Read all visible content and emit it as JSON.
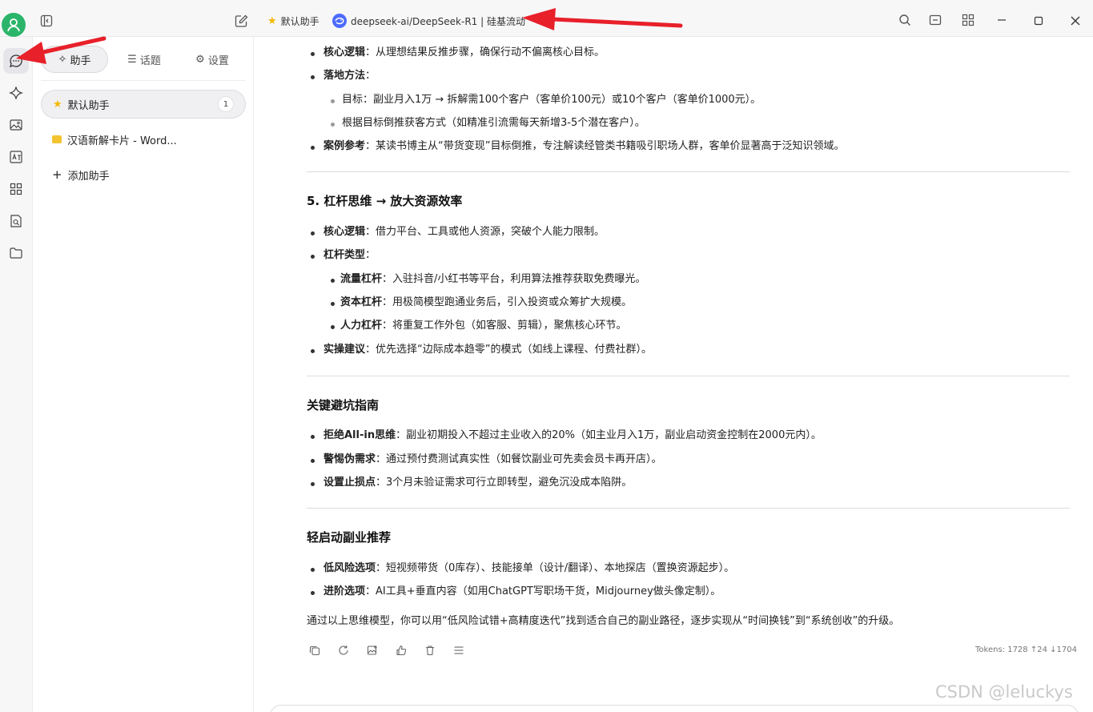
{
  "titlebar": {
    "assistant_tab": "默认助手",
    "model_tab": "deepseek-ai/DeepSeek-R1 | 硅基流动"
  },
  "sidebar": {
    "tabs": [
      {
        "label": "助手",
        "icon": "sparkle-icon"
      },
      {
        "label": "话题",
        "icon": "list-icon"
      },
      {
        "label": "设置",
        "icon": "gear-icon"
      }
    ],
    "items": [
      {
        "label": "默认助手",
        "icon": "star-icon",
        "badge": "1"
      },
      {
        "label": "汉语新解卡片 - Word...",
        "icon": "card-icon"
      }
    ],
    "add_label": "添加助手"
  },
  "message": {
    "s4_logic_label": "核心逻辑",
    "s4_logic_text": "：从理想结果反推步骤，确保行动不偏离核心目标。",
    "s4_method_label": "落地方法",
    "s4_method_colon": "：",
    "s4_method_1": "目标：副业月入1万 → 拆解需100个客户（客单价100元）或10个客户（客单价1000元）。",
    "s4_method_2": "根据目标倒推获客方式（如精准引流需每天新增3-5个潜在客户）。",
    "s4_case_label": "案例参考",
    "s4_case_text": "：某读书博主从“带货变现”目标倒推，专注解读经管类书籍吸引职场人群，客单价显著高于泛知识领域。",
    "s5_heading": "5. 杠杆思维 → 放大资源效率",
    "s5_logic_label": "核心逻辑",
    "s5_logic_text": "：借力平台、工具或他人资源，突破个人能力限制。",
    "s5_type_label": "杠杆类型",
    "s5_type_colon": "：",
    "s5_traffic_label": "流量杠杆",
    "s5_traffic_text": "：入驻抖音/小红书等平台，利用算法推荐获取免费曝光。",
    "s5_capital_label": "资本杠杆",
    "s5_capital_text": "：用极简模型跑通业务后，引入投资或众筹扩大规模。",
    "s5_labor_label": "人力杠杆",
    "s5_labor_text": "：将重复工作外包（如客服、剪辑），聚焦核心环节。",
    "s5_advice_label": "实操建议",
    "s5_advice_text": "：优先选择“边际成本趋零”的模式（如线上课程、付费社群）。",
    "pit_heading": "关键避坑指南",
    "pit_1_label": "拒绝All-in思维",
    "pit_1_text": "：副业初期投入不超过主业收入的20%（如主业月入1万，副业启动资金控制在2000元内）。",
    "pit_2_label": "警惕伪需求",
    "pit_2_text": "：通过预付费测试真实性（如餐饮副业可先卖会员卡再开店）。",
    "pit_3_label": "设置止损点",
    "pit_3_text": "：3个月未验证需求可行立即转型，避免沉没成本陷阱。",
    "rec_heading": "轻启动副业推荐",
    "rec_1_label": "低风险选项",
    "rec_1_text": "：短视频带货（0库存）、技能接单（设计/翻译）、本地探店（置换资源起步）。",
    "rec_2_label": "进阶选项",
    "rec_2_text": "：AI工具+垂直内容（如用ChatGPT写职场干货，Midjourney做头像定制）。",
    "conclusion": "通过以上思维模型，你可以用“低风险试错+高精度迭代”找到适合自己的副业路径，逐步实现从“时间换钱”到“系统创收”的升级。",
    "tokens": "Tokens: 1728 ↑24 ↓1704"
  },
  "watermark": "CSDN @leluckys",
  "colors": {
    "annotation_arrow": "#e8202a",
    "avatar": "#2bb56a",
    "deepseek_logo": "#4d6bfe"
  }
}
